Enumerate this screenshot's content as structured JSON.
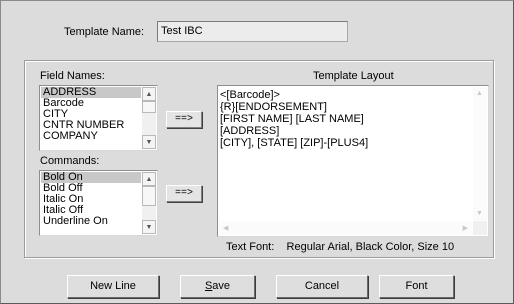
{
  "template_name": {
    "label": "Template Name:",
    "value": "Test IBC"
  },
  "field_names": {
    "label": "Field Names:",
    "items": [
      "ADDRESS",
      "Barcode",
      "CITY",
      "CNTR NUMBER",
      "COMPANY"
    ],
    "selected": "ADDRESS"
  },
  "commands": {
    "label": "Commands:",
    "items": [
      "Bold On",
      "Bold Off",
      "Italic On",
      "Italic Off",
      "Underline On"
    ],
    "selected": "Bold On"
  },
  "insert_field_button": "==>",
  "insert_command_button": "==>",
  "template_layout": {
    "label": "Template Layout",
    "lines": [
      "<[Barcode]>",
      "{R}[ENDORSEMENT]",
      "[FIRST NAME] [LAST NAME]",
      "[ADDRESS]",
      "[CITY], [STATE] [ZIP]-[PLUS4]"
    ]
  },
  "text_font": {
    "label": "Text Font:",
    "value": "Regular Arial, Black Color, Size 10"
  },
  "buttons": {
    "new_line": "New Line",
    "save_first": "S",
    "save_rest": "ave",
    "cancel": "Cancel",
    "font": "Font"
  },
  "icons": {
    "scroll_up": "triangle-up",
    "scroll_down": "triangle-down",
    "scroll_left": "triangle-left",
    "scroll_right": "triangle-right"
  }
}
